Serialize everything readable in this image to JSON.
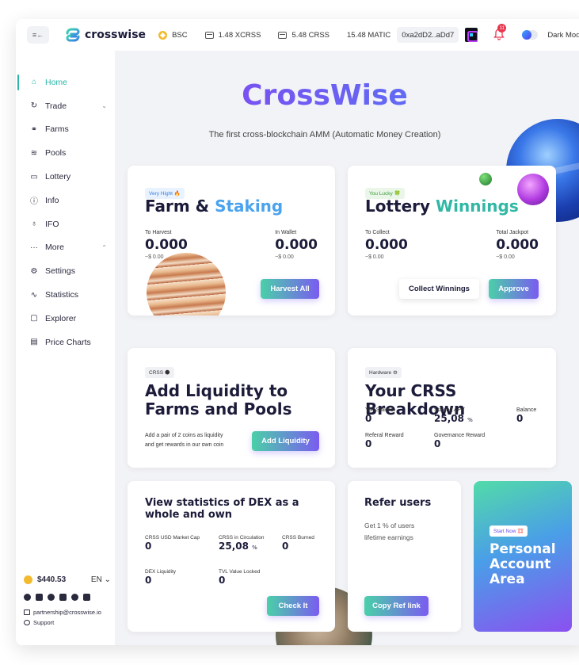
{
  "topbar": {
    "brand": "crosswise",
    "network": "BSC",
    "xcrss_balance": "1.48 XCRSS",
    "crss_balance": "5.48 CRSS",
    "matic_balance": "15.48 MATIC",
    "address": "0xa2dD2..aDd7",
    "notification_count": "11",
    "dark_mode_label": "Dark Mode"
  },
  "sidebar": {
    "items": [
      {
        "label": "Home",
        "icon": "home-icon"
      },
      {
        "label": "Trade",
        "icon": "trade-icon"
      },
      {
        "label": "Farms",
        "icon": "farms-icon"
      },
      {
        "label": "Pools",
        "icon": "pools-icon"
      },
      {
        "label": "Lottery",
        "icon": "lottery-icon"
      },
      {
        "label": "Info",
        "icon": "info-icon"
      },
      {
        "label": "IFO",
        "icon": "ifo-icon"
      },
      {
        "label": "More",
        "icon": "more-icon"
      },
      {
        "label": "Settings",
        "icon": "settings-icon"
      },
      {
        "label": "Statistics",
        "icon": "statistics-icon"
      },
      {
        "label": "Explorer",
        "icon": "explorer-icon"
      },
      {
        "label": "Price Charts",
        "icon": "price-charts-icon"
      }
    ],
    "price": "$440.53",
    "language": "EN",
    "email": "partnership@crosswise.io",
    "support": "Support"
  },
  "hero": {
    "title": "CrossWise",
    "subtitle": "The first cross-blockchain AMM (Automatic Money Creation)"
  },
  "farm": {
    "tag": "Very Hight 🔥",
    "title_a": "Farm & ",
    "title_b": "Staking",
    "harvest_label": "To Harvest",
    "harvest_value": "0.000",
    "harvest_usd": "~$ 0.00",
    "wallet_label": "In Wallet",
    "wallet_value": "0.000",
    "wallet_usd": "~$ 0.00",
    "button": "Harvest All"
  },
  "lottery": {
    "tag": "You Lucky 🍀",
    "title_a": "Lottery ",
    "title_b": "Winnings",
    "collect_label": "To Collect",
    "collect_value": "0.000",
    "collect_usd": "~$ 0.00",
    "jackpot_label": "Total Jackpot",
    "jackpot_value": "0.000",
    "jackpot_usd": "~$ 0.00",
    "collect_button": "Collect Winnings",
    "approve_button": "Approve"
  },
  "liquidity": {
    "tag": "CRSS 🌑",
    "title": "Add Liquidity to Farms and Pools",
    "desc_1": "Add a pair of 2 coins as liquidity",
    "desc_2": "and get rewards in our own coin",
    "button": "Add Liquidity"
  },
  "breakdown": {
    "tag": "Hardware ⚙",
    "title": "Your CRSS Breakdown",
    "staked_label": "You Staked",
    "staked_value": "0",
    "apy_label": "Staking APY",
    "apy_value": "25,08",
    "apy_unit": "%",
    "balance_label": "Balance",
    "balance_value": "0",
    "referral_label": "Referal Reward",
    "referral_value": "0",
    "governance_label": "Governance Reward",
    "governance_value": "0"
  },
  "dex": {
    "title": "View statistics of DEX as a whole and own",
    "market_cap_label": "CRSS USD Market Cap",
    "market_cap_value": "0",
    "circulation_label": "CRSS in Circulation",
    "circulation_value": "25,08",
    "circulation_unit": "%",
    "burned_label": "CRSS Burned",
    "burned_value": "0",
    "liquidity_label": "DEX Liquidity",
    "liquidity_value": "0",
    "tvl_label": "TVL Value Locked",
    "tvl_value": "0",
    "button": "Check It"
  },
  "refer": {
    "title": "Refer users",
    "desc_1": "Get 1 % of users",
    "desc_2": "lifetime earnings",
    "button": "Copy Ref link"
  },
  "personal": {
    "tag": "Start Now 💢",
    "title": "Personal Account Area"
  }
}
